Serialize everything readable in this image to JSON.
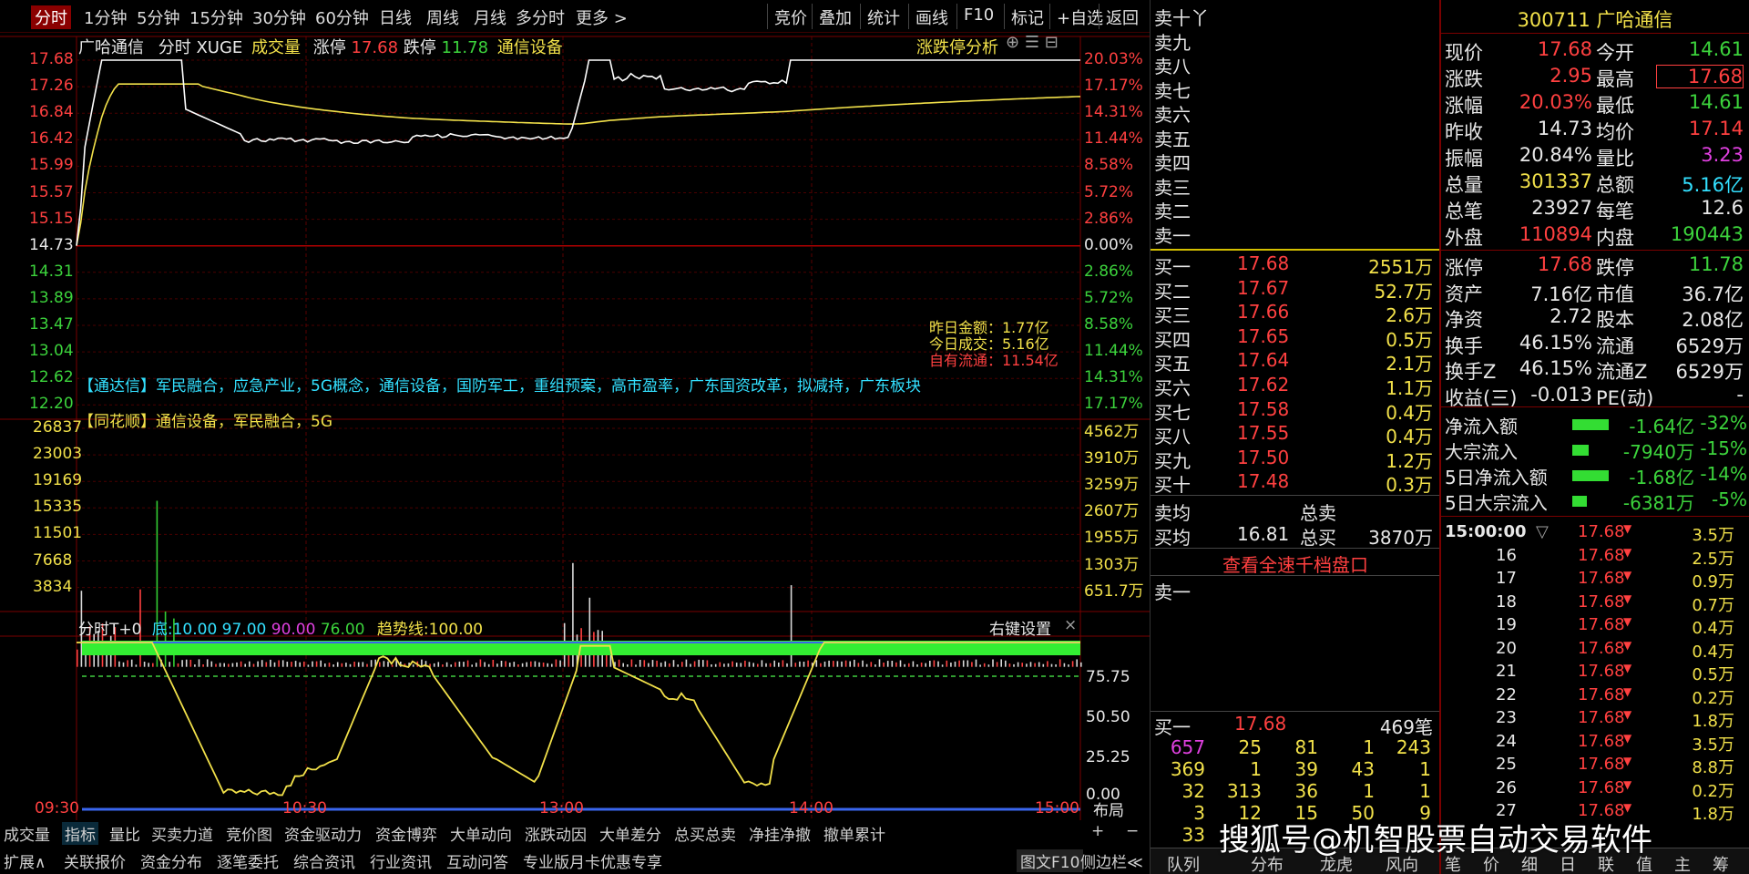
{
  "toolbar": {
    "tabs": [
      "分时",
      "1分钟",
      "5分钟",
      "15分钟",
      "30分钟",
      "60分钟",
      "日线",
      "周线",
      "月线",
      "多分时",
      "更多"
    ],
    "right": [
      "竞价",
      "叠加",
      "统计",
      "画线",
      "F10",
      "标记",
      "+自选",
      "返回"
    ]
  },
  "header": {
    "name": "广哈通信",
    "mode": "分时",
    "indicator": "XUGE",
    "volume_label": "成交量",
    "limit_up_label": "涨停",
    "limit_up": "17.68",
    "limit_down_label": "跌停",
    "limit_down": "11.78",
    "sector": "通信设备",
    "analysis": "涨跌停分析"
  },
  "price_axis": {
    "left": [
      "17.68",
      "17.26",
      "16.84",
      "16.42",
      "15.99",
      "15.57",
      "15.15",
      "14.73",
      "14.31",
      "13.89",
      "13.47",
      "13.04",
      "12.62",
      "12.20"
    ],
    "right": [
      "20.03%",
      "17.17%",
      "14.31%",
      "11.44%",
      "8.58%",
      "5.72%",
      "2.86%",
      "0.00%",
      "2.86%",
      "5.72%",
      "8.58%",
      "11.44%",
      "14.31%",
      "17.17%"
    ]
  },
  "volume_axis": {
    "left": [
      "26837",
      "23003",
      "19169",
      "15335",
      "11501",
      "7668",
      "3834"
    ],
    "right": [
      "4562万",
      "3910万",
      "3259万",
      "2607万",
      "1955万",
      "1303万",
      "651.7万"
    ]
  },
  "turnover": {
    "yesterday": "昨日金额：1.77亿",
    "today": "今日成交：5.16亿",
    "float": "自有流通：11.54亿"
  },
  "concepts": {
    "tdx": "【通达信】军民融合，应急产业，5G概念，通信设备，国防军工，重组预案，高市盈率，广东国资改革，拟减持，广东板块",
    "ths_tag": "【同花顺】",
    "ths": "通信设备，军民融合，5G"
  },
  "indicator_panel": {
    "title": "分时T+0",
    "bottom_label": "底:",
    "v1": "10.00",
    "v2": "97.00",
    "v3": "90.00",
    "v4": "76.00",
    "trend_label": "趋势线:",
    "trend": "100.00",
    "settings": "右键设置",
    "close": "×",
    "axis": [
      "75.75",
      "50.50",
      "25.25",
      "0.00"
    ]
  },
  "time_axis": [
    "09:30",
    "10:30",
    "13:00",
    "14:00",
    "15:00"
  ],
  "layout_btn": "布局",
  "plus_minus": [
    "+",
    "−"
  ],
  "bottom_tabs1": [
    "成交量",
    "指标",
    "量比",
    "买卖力道",
    "竞价图",
    "资金驱动力",
    "资金博弈",
    "大单动向",
    "涨跌动因",
    "大单差分",
    "总买总卖",
    "净挂净撤",
    "撤单累计"
  ],
  "bottom_tabs2": [
    "扩展∧",
    "关联报价",
    "资金分布",
    "逐笔委托",
    "综合资讯",
    "行业资讯",
    "互动问答",
    "专业版月卡优惠专享"
  ],
  "bottom_right": "图文F10",
  "bottom_right2": "侧边栏≪",
  "asks": [
    "卖十丫",
    "卖九",
    "卖八",
    "卖七",
    "卖六",
    "卖五",
    "卖四",
    "卖三",
    "卖二",
    "卖一"
  ],
  "bids": [
    {
      "l": "买一",
      "p": "17.68",
      "v": "2551万"
    },
    {
      "l": "买二",
      "p": "17.67",
      "v": "52.7万"
    },
    {
      "l": "买三",
      "p": "17.66",
      "v": "2.6万"
    },
    {
      "l": "买四",
      "p": "17.65",
      "v": "0.5万"
    },
    {
      "l": "买五",
      "p": "17.64",
      "v": "2.1万"
    },
    {
      "l": "买六",
      "p": "17.62",
      "v": "1.1万"
    },
    {
      "l": "买七",
      "p": "17.58",
      "v": "0.4万"
    },
    {
      "l": "买八",
      "p": "17.55",
      "v": "0.4万"
    },
    {
      "l": "买九",
      "p": "17.50",
      "v": "1.2万"
    },
    {
      "l": "买十",
      "p": "17.48",
      "v": "0.3万"
    }
  ],
  "avg": {
    "sell_label": "卖均",
    "sell_total_label": "总卖",
    "buy_label": "买均",
    "buy_price": "16.81",
    "buy_total_label": "总买",
    "buy_total": "3870万"
  },
  "full_depth": "查看全速千档盘口",
  "queue": {
    "sell1": "卖一",
    "buy1": "买一",
    "buy1_price": "17.68",
    "buy1_count": "469笔",
    "rows": [
      [
        "657",
        "25",
        "81",
        "1",
        "243"
      ],
      [
        "369",
        "1",
        "39",
        "43",
        "1"
      ],
      [
        "32",
        "313",
        "36",
        "1",
        "1"
      ],
      [
        "3",
        "12",
        "15",
        "50",
        "9"
      ],
      [
        "33",
        "",
        "",
        "",
        ""
      ]
    ]
  },
  "tabs_side": [
    "队列",
    "分布",
    "龙虎",
    "风向"
  ],
  "stock": {
    "code": "300711",
    "name": "广哈通信"
  },
  "quote": [
    [
      "现价",
      "17.68",
      "今开",
      "14.61"
    ],
    [
      "涨跌",
      "2.95",
      "最高",
      "17.68"
    ],
    [
      "涨幅",
      "20.03%",
      "最低",
      "14.61"
    ],
    [
      "昨收",
      "14.73",
      "均价",
      "17.14"
    ],
    [
      "振幅",
      "20.84%",
      "量比",
      "3.23"
    ],
    [
      "总量",
      "301337",
      "总额",
      "5.16亿"
    ],
    [
      "总笔",
      "23927",
      "每笔",
      "12.6"
    ],
    [
      "外盘",
      "110894",
      "内盘",
      "190443"
    ]
  ],
  "quote2": [
    [
      "涨停",
      "17.68",
      "跌停",
      "11.78"
    ],
    [
      "资产",
      "7.16亿",
      "市值",
      "36.7亿"
    ],
    [
      "净资",
      "2.72",
      "股本",
      "2.08亿"
    ],
    [
      "换手",
      "46.15%",
      "流通",
      "6529万"
    ],
    [
      "换手Z",
      "46.15%",
      "流通Z",
      "6529万"
    ],
    [
      "收益(三)",
      "-0.013",
      "PE(动)",
      "-"
    ]
  ],
  "flow": [
    [
      "净流入额",
      "-1.64亿",
      "-32%"
    ],
    [
      "大宗流入",
      "-7940万",
      "-15%"
    ],
    [
      "5日净流入额",
      "-1.68亿",
      "-14%"
    ],
    [
      "5日大宗流入",
      "-6381万",
      "-5%"
    ]
  ],
  "ticks": [
    [
      "15:00:00",
      "17.68",
      "3.5万"
    ],
    [
      "16",
      "17.68",
      "2.5万"
    ],
    [
      "17",
      "17.68",
      "0.9万"
    ],
    [
      "18",
      "17.68",
      "0.7万"
    ],
    [
      "19",
      "17.68",
      "0.4万"
    ],
    [
      "20",
      "17.68",
      "0.4万"
    ],
    [
      "21",
      "17.68",
      "0.5万"
    ],
    [
      "22",
      "17.68",
      "0.2万"
    ],
    [
      "23",
      "17.68",
      "1.8万"
    ],
    [
      "24",
      "17.68",
      "3.5万"
    ],
    [
      "25",
      "17.68",
      "8.8万"
    ],
    [
      "26",
      "17.68",
      "0.2万"
    ],
    [
      "27",
      "17.68",
      "1.8万"
    ]
  ],
  "bottom_tabs_right": [
    "笔",
    "价",
    "细",
    "日",
    "联",
    "值",
    "主",
    "筹"
  ],
  "watermark": "搜狐号@机智股票自动交易软件",
  "colors": {
    "up": "#ff4040",
    "down": "#3cd33c",
    "avg": "#f2e14a",
    "price": "#ffffff",
    "grid": "#5a0000"
  }
}
